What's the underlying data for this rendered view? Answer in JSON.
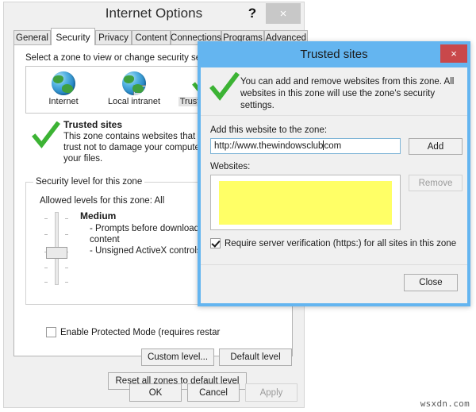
{
  "watermark": "wsxdn.com",
  "internet_options": {
    "title": "Internet Options",
    "help_icon": "?",
    "close_icon": "×",
    "tabs": [
      {
        "label": "General",
        "selected": false
      },
      {
        "label": "Security",
        "selected": true
      },
      {
        "label": "Privacy",
        "selected": false
      },
      {
        "label": "Content",
        "selected": false
      },
      {
        "label": "Connections",
        "selected": false
      },
      {
        "label": "Programs",
        "selected": false
      },
      {
        "label": "Advanced",
        "selected": false
      }
    ],
    "security_tab": {
      "zone_prompt": "Select a zone to view or change security setting",
      "zones": [
        {
          "label": "Internet",
          "icon": "globe-icon",
          "selected": false
        },
        {
          "label": "Local intranet",
          "icon": "globe-monitor-icon",
          "selected": false
        },
        {
          "label": "Trusted sites",
          "icon": "green-check-icon",
          "selected": true
        }
      ],
      "zone_description_title": "Trusted sites",
      "zone_description_text": "This zone contains websites that you trust not to damage your computer or your files.",
      "security_level_legend": "Security level for this zone",
      "allowed_levels": "Allowed levels for this zone: All",
      "level_name": "Medium",
      "level_description": "- Prompts before downloading p content\n- Unsigned ActiveX controls will",
      "protected_mode_label": "Enable Protected Mode (requires restar",
      "protected_mode_checked": false,
      "custom_level_button": "Custom level...",
      "default_level_button": "Default level",
      "reset_all_button": "Reset all zones to default level"
    },
    "footer": {
      "ok_button": "OK",
      "cancel_button": "Cancel",
      "apply_button": "Apply",
      "apply_disabled": true
    }
  },
  "trusted_sites_dialog": {
    "title": "Trusted sites",
    "close_icon": "×",
    "header_icon": "green-check-icon",
    "header_text": "You can add and remove websites from this zone. All websites in this zone will use the zone's security settings.",
    "add_label": "Add this website to the zone:",
    "url_value": "http://www.thewindowsclub",
    "url_value_after_caret": "com",
    "add_button": "Add",
    "websites_label": "Websites:",
    "websites_list_items": [],
    "websites_list_redacted": true,
    "redaction_color": "#ffff66",
    "remove_button": "Remove",
    "remove_disabled": true,
    "verify_label": "Require server verification (https:) for all sites in this zone",
    "verify_checked": true,
    "close_button": "Close"
  },
  "colors": {
    "dialog_accent": "#64b5f0",
    "close_red": "#c9484b",
    "window_bg": "#f0f0f0",
    "check_green": "#3cb334"
  }
}
